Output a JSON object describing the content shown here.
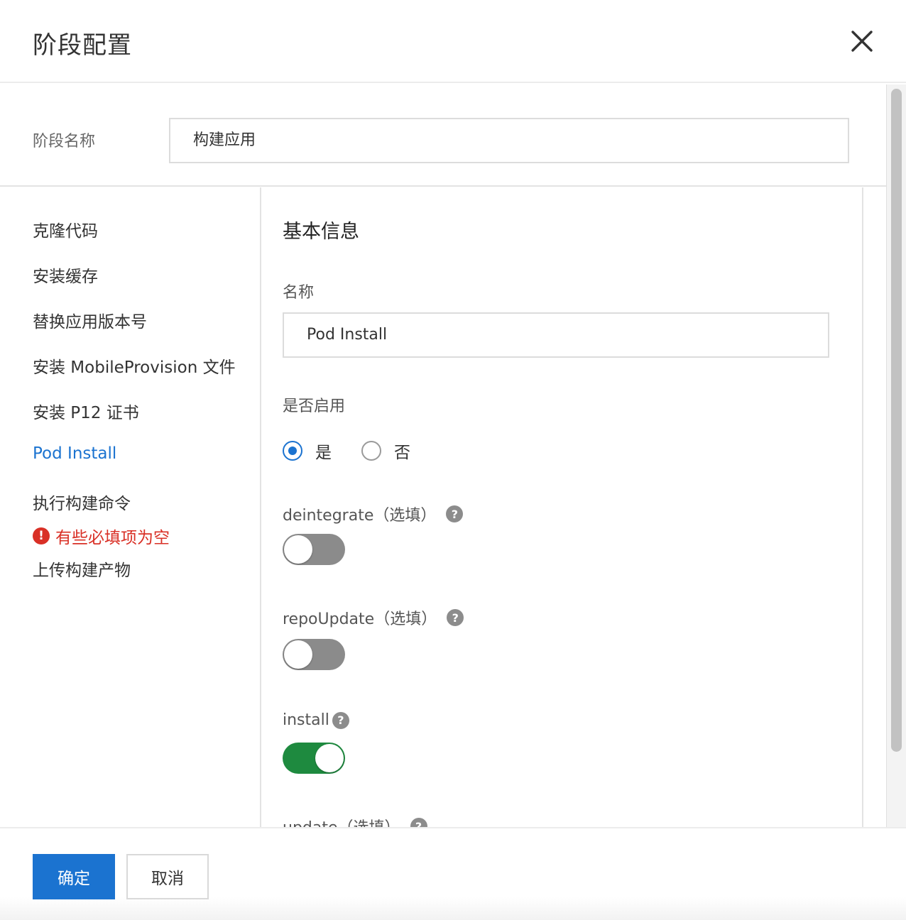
{
  "dialog": {
    "title": "阶段配置",
    "close_icon": "close-icon"
  },
  "stage": {
    "label": "阶段名称",
    "value": "构建应用"
  },
  "steps": [
    {
      "label": "克隆代码",
      "active": false
    },
    {
      "label": "安装缓存",
      "active": false
    },
    {
      "label": "替换应用版本号",
      "active": false
    },
    {
      "label": "安装 MobileProvision 文件",
      "active": false
    },
    {
      "label": "安装 P12 证书",
      "active": false
    },
    {
      "label": "Pod Install",
      "active": true
    },
    {
      "label": "执行构建命令",
      "active": false,
      "error": "有些必填项为空"
    },
    {
      "label": "上传构建产物",
      "active": false
    }
  ],
  "step_error_icon": "exclamation-circle-icon",
  "main": {
    "section_title": "基本信息",
    "name_label": "名称",
    "name_value": "Pod Install",
    "enabled_label": "是否启用",
    "enabled_options": [
      "是",
      "否"
    ],
    "enabled_selected": "是",
    "fields": [
      {
        "label": "deintegrate（选填）",
        "help_icon": "question-circle-icon",
        "enabled": false
      },
      {
        "label": "repoUpdate（选填）",
        "help_icon": "question-circle-icon",
        "enabled": false
      },
      {
        "label": "install",
        "help_icon": "question-circle-icon",
        "enabled": true
      },
      {
        "label": "update（选填）",
        "help_icon": "question-circle-icon"
      }
    ]
  },
  "footer": {
    "confirm_label": "确定",
    "cancel_label": "取消"
  },
  "colors": {
    "primary": "#1b73d0",
    "error": "#d93026",
    "toggle_on": "#1e8a3f",
    "toggle_off": "#8b8b8b"
  }
}
